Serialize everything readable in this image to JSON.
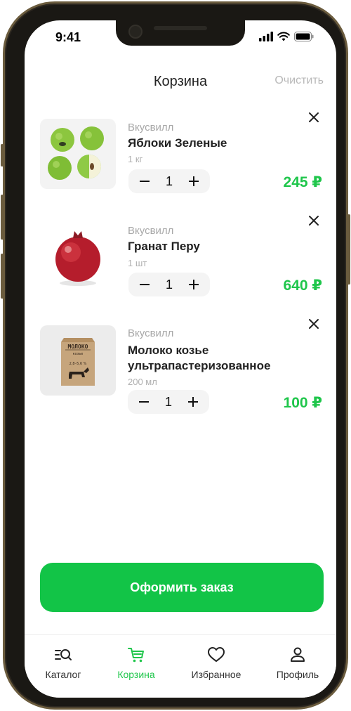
{
  "status": {
    "time": "9:41"
  },
  "header": {
    "title": "Корзина",
    "clear_label": "Очистить"
  },
  "cart": {
    "items": [
      {
        "brand": "Вкусвилл",
        "name": "Яблоки Зеленые",
        "unit": "1 кг",
        "quantity": "1",
        "price": "245 ₽",
        "image": "green-apples"
      },
      {
        "brand": "Вкусвилл",
        "name": "Гранат Перу",
        "unit": "1 шт",
        "quantity": "1",
        "price": "640 ₽",
        "image": "pomegranate"
      },
      {
        "brand": "Вкусвилл",
        "name": "Молоко козье ультрапастеризованное",
        "unit": "200 мл",
        "quantity": "1",
        "price": "100 ₽",
        "image": "goat-milk-carton",
        "package_text": "МОЛОКО",
        "package_sub": "козье",
        "package_pct": "2,8–5,6 %"
      }
    ]
  },
  "checkout": {
    "label": "Оформить заказ"
  },
  "tabbar": {
    "tabs": [
      {
        "label": "Каталог",
        "icon": "catalog-search-icon",
        "active": false
      },
      {
        "label": "Корзина",
        "icon": "cart-icon",
        "active": true
      },
      {
        "label": "Избранное",
        "icon": "heart-icon",
        "active": false
      },
      {
        "label": "Профиль",
        "icon": "profile-icon",
        "active": false
      }
    ]
  },
  "colors": {
    "accent": "#12c447",
    "price": "#1fc64b",
    "muted": "#a8a8a8"
  }
}
